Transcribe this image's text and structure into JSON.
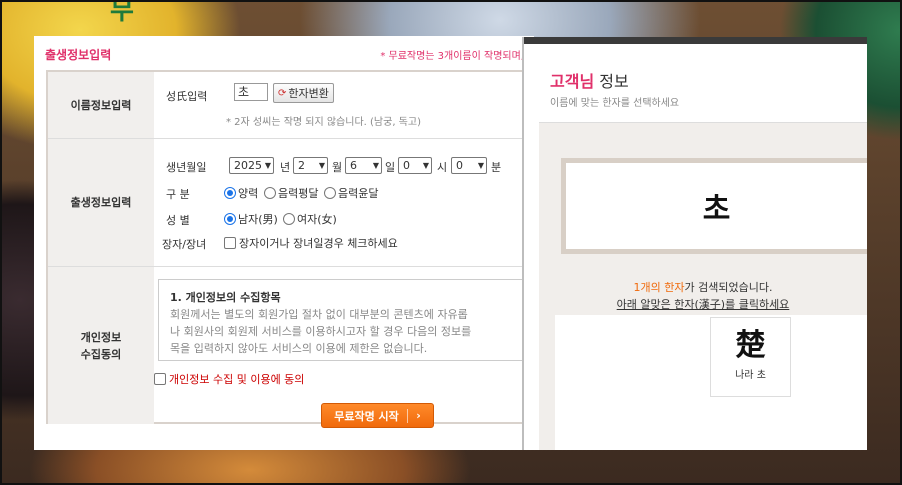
{
  "background": {
    "lantern_text": "무"
  },
  "form": {
    "title": "출생정보입력",
    "notice": "* 무료작명는 3개이름이 작명되며,",
    "name_row": {
      "label": "이름정보입력",
      "surname_label": "성氏입력",
      "surname_value": "초",
      "convert_button": "한자변환",
      "convert_icon": "refresh-icon",
      "note": "* 2자 성씨는 작명 되지 않습니다. (남궁, 독고)"
    },
    "birth_row": {
      "label": "출생정보입력",
      "date_label": "생년월일",
      "year": "2025",
      "year_unit": "년",
      "month": "2",
      "month_unit": "월",
      "day": "6",
      "day_unit": "일",
      "hour": "0",
      "hour_unit": "시",
      "minute": "0",
      "minute_unit": "분",
      "calendar_label": "구 분",
      "calendar_options": [
        "양력",
        "음력평달",
        "음력윤달"
      ],
      "gender_label": "성 별",
      "gender_options": [
        "남자(男)",
        "여자(女)"
      ],
      "eldest_label": "장자/장녀",
      "eldest_check": "장자이거나 장녀일경우 체크하세요"
    },
    "consent_row": {
      "label_line1": "개인정보",
      "label_line2": "수집동의",
      "box_title": "1. 개인정보의 수집항목",
      "box_text1": "회원께서는 별도의 회원가입 절차 없이 대부분의 콘텐츠에 자유롭",
      "box_text2": "나 회원사의 회원제 서비스를 이용하시고자 할 경우 다음의 정보를",
      "box_text3": "목을 입력하지 않아도 서비스의 이용에 제한은 없습니다.",
      "agree_label": "개인정보 수집 및 이용에 동의"
    },
    "start_button": "무료작명 시작"
  },
  "popup": {
    "title_highlight": "고객님",
    "title_rest": " 정보",
    "subtitle": "이름에 맞는 한자를 선택하세요",
    "name_char": "초",
    "result_count": "1개의 한자",
    "result_suffix": "가 검색되었습니다.",
    "result_hint": "아래 알맞은 한자(漢子)를 클릭하세요",
    "hanja": [
      {
        "char": "楚",
        "reading": "나라 초"
      }
    ]
  },
  "colors": {
    "accent": "#e0306a",
    "button": "#f06a0c",
    "radio": "#1a73e8"
  }
}
